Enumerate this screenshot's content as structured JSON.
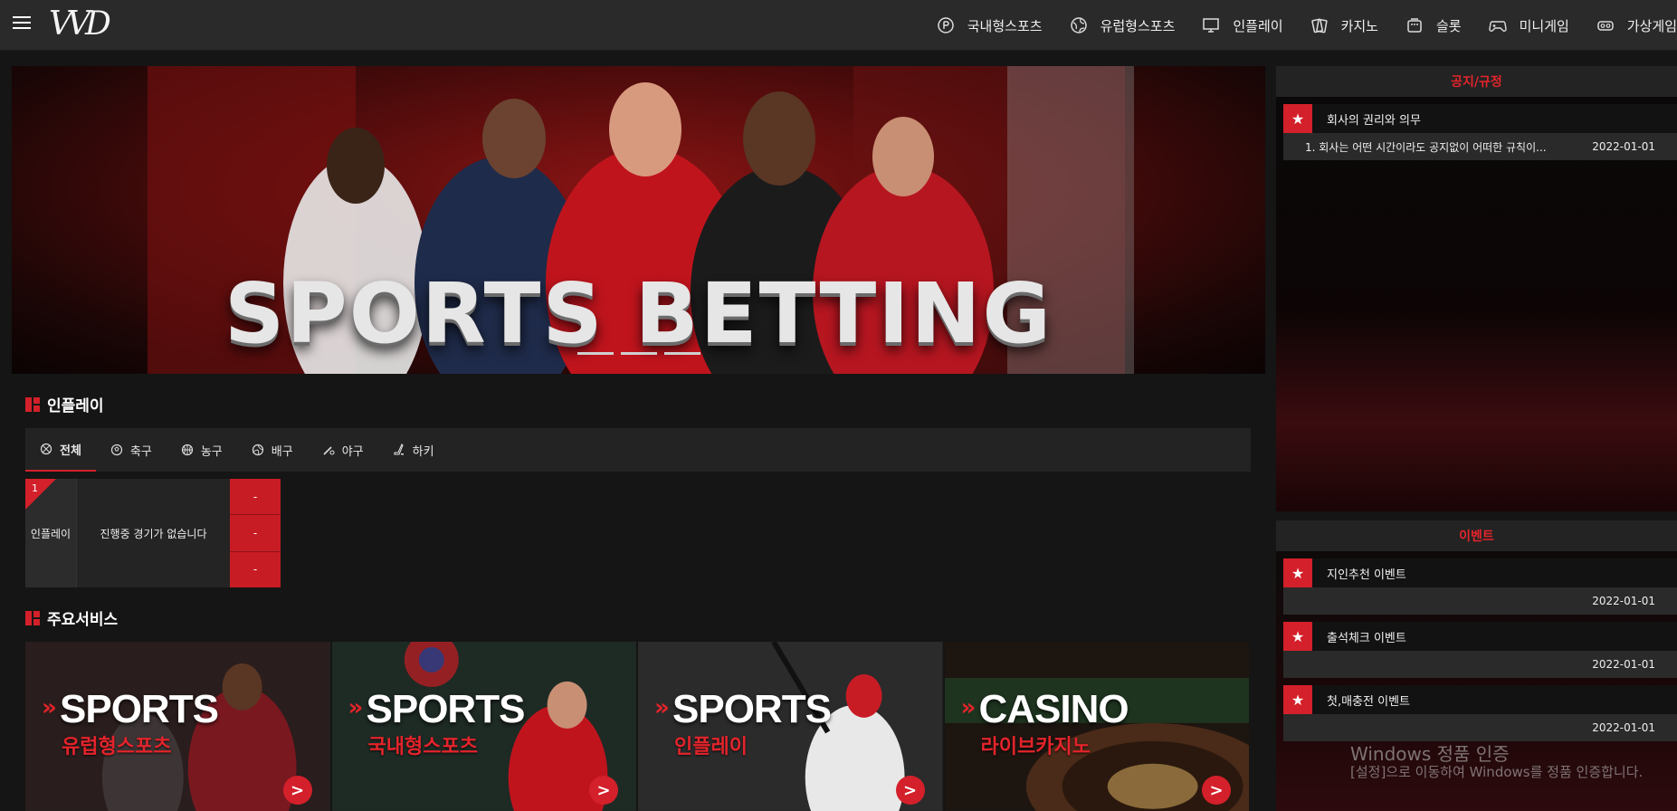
{
  "header": {
    "logo": "VVD",
    "nav": [
      {
        "label": "국내형스포츠",
        "icon": "coin-icon"
      },
      {
        "label": "유럽형스포츠",
        "icon": "globe-icon"
      },
      {
        "label": "인플레이",
        "icon": "live-monitor-icon"
      },
      {
        "label": "카지노",
        "icon": "cards-icon"
      },
      {
        "label": "슬롯",
        "icon": "slot-machine-icon"
      },
      {
        "label": "미니게임",
        "icon": "gamepad-icon"
      },
      {
        "label": "가상게임",
        "icon": "vr-headset-icon"
      }
    ]
  },
  "banner": {
    "title": "SPORTS BETTING",
    "slides": 3
  },
  "inplay": {
    "section_title": "인플레이",
    "tabs": [
      {
        "label": "전체",
        "icon": "all-ball-icon",
        "active": true
      },
      {
        "label": "축구",
        "icon": "soccer-icon",
        "active": false
      },
      {
        "label": "농구",
        "icon": "basketball-icon",
        "active": false
      },
      {
        "label": "배구",
        "icon": "volleyball-icon",
        "active": false
      },
      {
        "label": "야구",
        "icon": "baseball-icon",
        "active": false
      },
      {
        "label": "하키",
        "icon": "hockey-icon",
        "active": false
      }
    ],
    "table": {
      "rank": "1",
      "category": "인플레이",
      "message": "진행중 경기가 없습니다",
      "odds": [
        "-",
        "-",
        "-"
      ]
    }
  },
  "services": {
    "section_title": "주요서비스",
    "cards": [
      {
        "en": "SPORTS",
        "ko": "유럽형스포츠",
        "chevron": "»",
        "go": ">"
      },
      {
        "en": "SPORTS",
        "ko": "국내형스포츠",
        "chevron": "»",
        "go": ">"
      },
      {
        "en": "SPORTS",
        "ko": "인플레이",
        "chevron": "»",
        "go": ">"
      },
      {
        "en": "CASINO",
        "ko": "라이브카지노",
        "chevron": "»",
        "go": ">"
      }
    ]
  },
  "notice": {
    "title": "공지/규정",
    "items": [
      {
        "title": "회사의 권리와 의무",
        "summary": "1. 회사는 어떤 시간이라도 공지없이 어떠한 규칙이...",
        "date": "2022-01-01"
      }
    ]
  },
  "events": {
    "title": "이벤트",
    "items": [
      {
        "title": "지인추천 이벤트",
        "date": "2022-01-01"
      },
      {
        "title": "출석체크 이벤트",
        "date": "2022-01-01"
      },
      {
        "title": "첫,매충전 이벤트",
        "date": "2022-01-01"
      }
    ]
  },
  "windows_watermark": {
    "line1": "Windows 정품 인증",
    "line2": "[설정]으로 이동하여 Windows를 정품 인증합니다."
  },
  "colors": {
    "accent": "#d3202a",
    "topbar": "#2a2a2a",
    "background": "#151515"
  }
}
